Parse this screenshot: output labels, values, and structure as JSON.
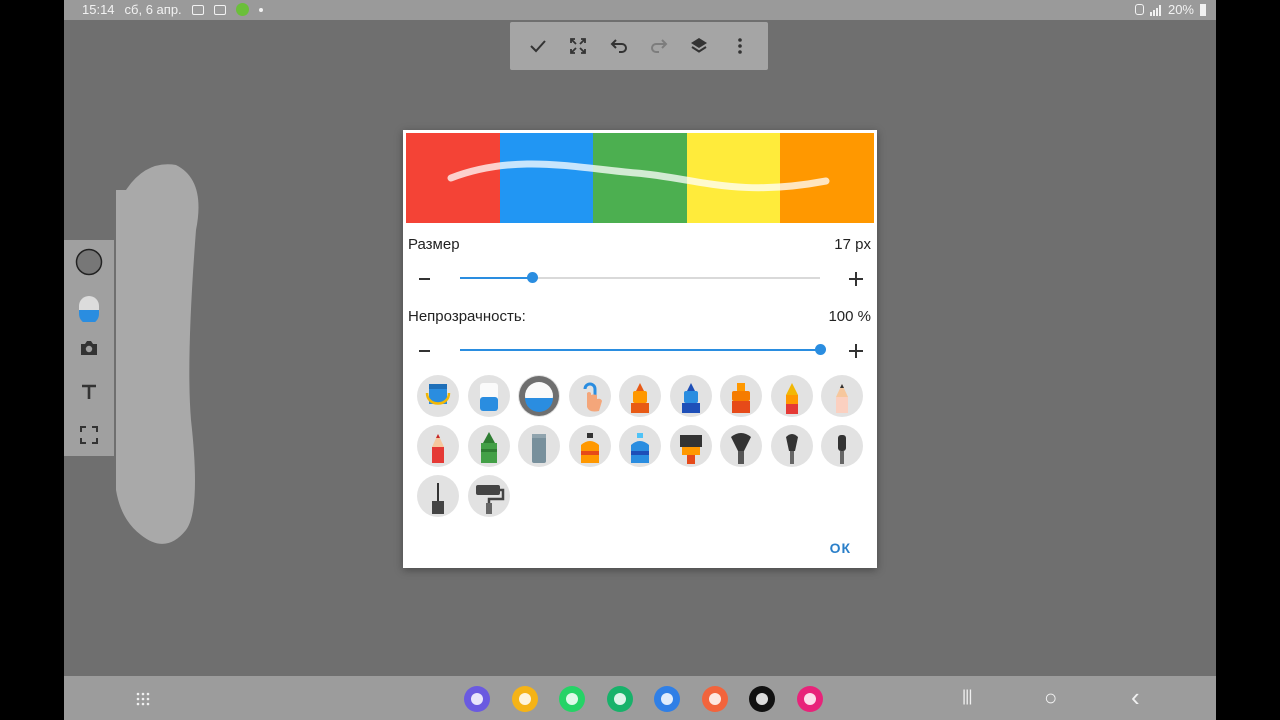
{
  "status_bar": {
    "time": "15:14",
    "date": "сб, 6 апр.",
    "battery": "20%"
  },
  "toolbar": {
    "buttons": [
      "check-icon",
      "fullscreen-icon",
      "undo-icon",
      "redo-icon",
      "layers-icon",
      "more-vert-icon"
    ]
  },
  "side_tools": [
    "color-circle-icon",
    "brush-icon",
    "camera-icon",
    "text-icon",
    "crop-icon"
  ],
  "dialog": {
    "preview_colors": [
      "#f44336",
      "#2196f3",
      "#4caf50",
      "#ffeb3b",
      "#ff9800"
    ],
    "size": {
      "label": "Размер",
      "value": "17 px",
      "fraction": 0.2
    },
    "opacity": {
      "label": "Непрозрачность:",
      "value": "100 %",
      "fraction": 1.0
    },
    "brushes": [
      "bucket-brush-icon",
      "eraser-brush-icon",
      "ring-eraser-icon",
      "finger-smudge-icon",
      "orange-marker-icon",
      "blue-marker-icon",
      "orange-highlighter-icon",
      "ink-pen-icon",
      "pencil-icon",
      "red-pencil-icon",
      "green-crayon-icon",
      "gray-chalk-icon",
      "orange-spray-icon",
      "blue-spray-icon",
      "flat-brush-icon",
      "fan-brush-icon",
      "round-brush-icon",
      "thin-brush-icon",
      "liner-brush-icon",
      "roller-brush-icon"
    ],
    "ok_label": "ОК"
  },
  "nav_bar": {
    "apps": [
      {
        "name": "browser-app-icon",
        "color": "#6a5ae0"
      },
      {
        "name": "files-app-icon",
        "color": "#f5b316"
      },
      {
        "name": "whatsapp-app-icon",
        "color": "#25d366"
      },
      {
        "name": "phone-app-icon",
        "color": "#17b26a"
      },
      {
        "name": "messages-app-icon",
        "color": "#2f7fe6"
      },
      {
        "name": "contacts-app-icon",
        "color": "#f2643c"
      },
      {
        "name": "capcut-app-icon",
        "color": "#111111"
      },
      {
        "name": "gallery-app-icon",
        "color": "#e8237a"
      }
    ],
    "recents": "|||",
    "home": "○",
    "back": "‹"
  }
}
